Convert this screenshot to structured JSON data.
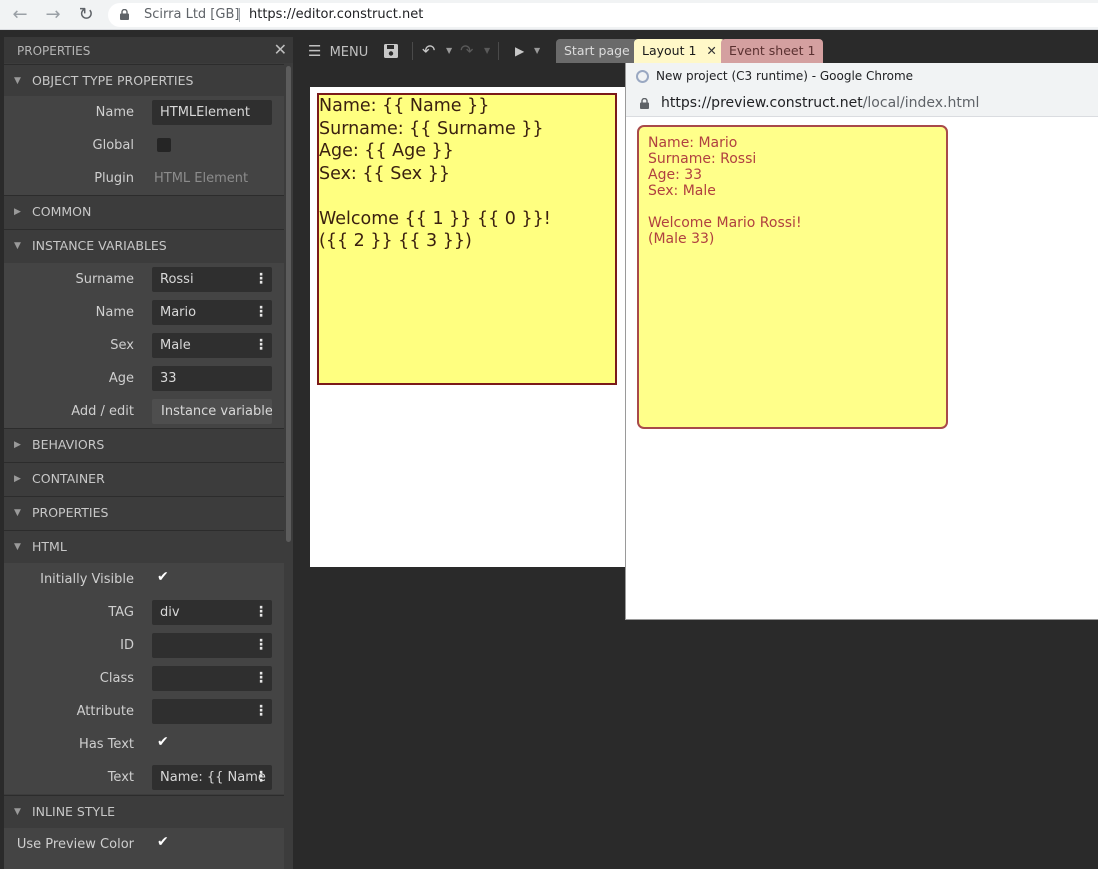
{
  "browser": {
    "back_icon": "arrow-left-icon",
    "forward_icon": "arrow-right-icon",
    "reload_icon": "reload-icon",
    "site_name": "Scirra Ltd [GB]",
    "url": "https://editor.construct.net"
  },
  "properties_panel": {
    "title": "PROPERTIES",
    "close_icon": "close-icon",
    "sections": {
      "object_type": "OBJECT TYPE PROPERTIES",
      "common": "COMMON",
      "instance_variables": "INSTANCE VARIABLES",
      "behaviors": "BEHAVIORS",
      "container": "CONTAINER",
      "properties": "PROPERTIES",
      "html": "HTML",
      "inline_style": "INLINE STYLE"
    },
    "object_type": {
      "name_label": "Name",
      "name_value": "HTMLElement",
      "global_label": "Global",
      "plugin_label": "Plugin",
      "plugin_value": "HTML Element"
    },
    "instance_vars": {
      "surname_label": "Surname",
      "surname_value": "Rossi",
      "name_label": "Name",
      "name_value": "Mario",
      "sex_label": "Sex",
      "sex_value": "Male",
      "age_label": "Age",
      "age_value": "33",
      "add_edit_label": "Add / edit",
      "add_edit_button": "Instance variables"
    },
    "html": {
      "initially_visible_label": "Initially Visible",
      "tag_label": "TAG",
      "tag_value": "div",
      "id_label": "ID",
      "id_value": "",
      "class_label": "Class",
      "class_value": "",
      "attribute_label": "Attribute",
      "attribute_value": "",
      "has_text_label": "Has Text",
      "text_label": "Text",
      "text_value": "Name: {{ Name"
    },
    "inline_style": {
      "use_preview_color_label": "Use Preview Color"
    }
  },
  "toolbar": {
    "menu_label": "MENU",
    "tabs": {
      "start_page": "Start page",
      "layout": "Layout 1",
      "event_sheet": "Event sheet 1"
    }
  },
  "layout_object": {
    "text": "Name: {{ Name }}\nSurname: {{ Surname }}\nAge: {{ Age }}\nSex: {{ Sex }}\n\nWelcome {{ 1 }} {{ 0 }}!\n({{ 2 }} {{ 3 }})"
  },
  "preview_window": {
    "title": "New project (C3 runtime) - Google Chrome",
    "url_host": "https://preview.construct.net",
    "url_path": "/local/index.html",
    "content": "Name: Mario\nSurname: Rossi\nAge: 33\nSex: Male\n\nWelcome Mario Rossi!\n(Male 33)"
  },
  "colors": {
    "panel_bg": "#3c3c3c",
    "layout_object_bg": "#ffff80",
    "layout_object_border": "#7b1a1a",
    "preview_text": "#b04040",
    "active_tab": "#fff8c8",
    "event_tab": "#d4a0a0"
  }
}
